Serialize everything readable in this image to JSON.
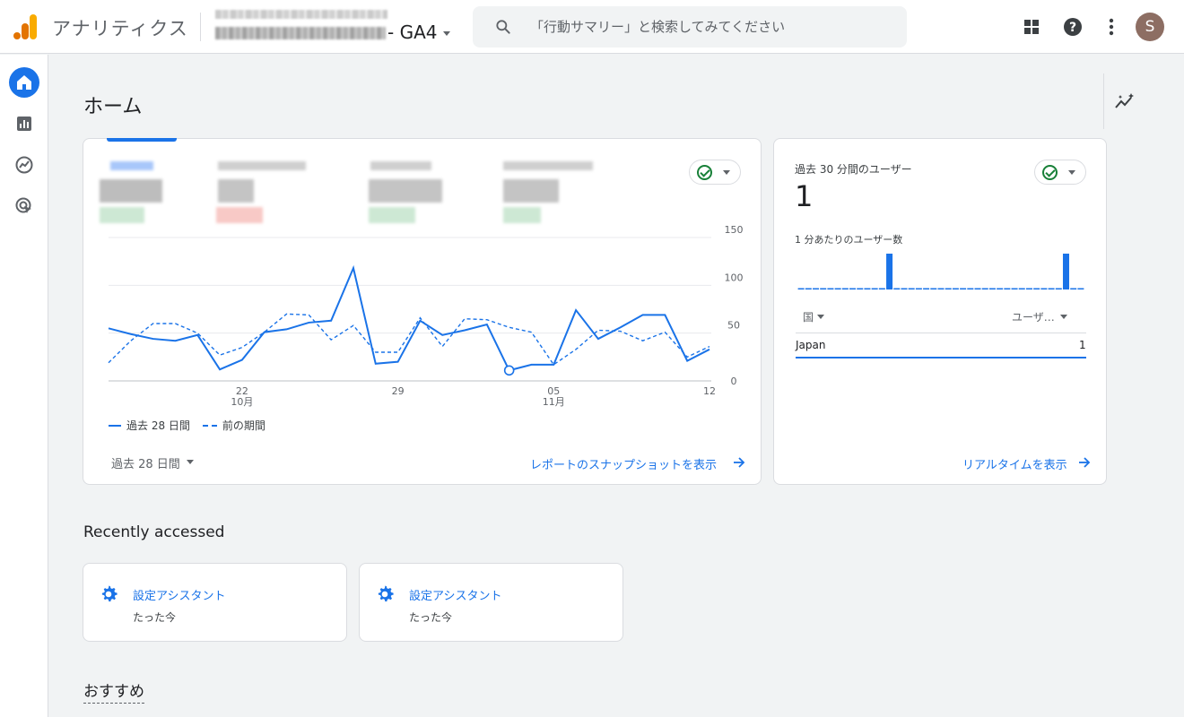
{
  "header": {
    "app_title": "アナリティクス",
    "property_name": "- GA4",
    "search_placeholder": "「行動サマリー」と検索してみてください",
    "avatar_initial": "S"
  },
  "nav": {
    "items": [
      "home-icon",
      "reports-icon",
      "explore-icon",
      "advertising-icon"
    ]
  },
  "page": {
    "title": "ホーム"
  },
  "overview_card": {
    "legend_current": "過去 28 日間",
    "legend_previous": "前の期間",
    "date_range": "過去 28 日間",
    "snapshot_link": "レポートのスナップショットを表示"
  },
  "chart_data": {
    "type": "line",
    "y_ticks": [
      "150",
      "100",
      "50",
      "0"
    ],
    "ylim": [
      0,
      150
    ],
    "x_ticks": [
      {
        "day": "22",
        "month": "10月",
        "index": 6
      },
      {
        "day": "29",
        "month": "",
        "index": 13
      },
      {
        "day": "05",
        "month": "11月",
        "index": 20
      },
      {
        "day": "12",
        "month": "",
        "index": 27
      }
    ],
    "series": [
      {
        "name": "過去 28 日間",
        "values": [
          55,
          49,
          44,
          42,
          48,
          12,
          22,
          51,
          54,
          61,
          63,
          118,
          18,
          20,
          63,
          48,
          53,
          59,
          11,
          17,
          17,
          74,
          44,
          56,
          69,
          69,
          21,
          33
        ]
      },
      {
        "name": "前の期間",
        "values": [
          19,
          42,
          60,
          60,
          50,
          27,
          35,
          51,
          70,
          69,
          43,
          58,
          30,
          30,
          66,
          36,
          65,
          64,
          56,
          51,
          17,
          33,
          53,
          52,
          42,
          51,
          25,
          36
        ]
      }
    ],
    "highlight_index": 18
  },
  "realtime_card": {
    "label": "過去 30 分間のユーザー",
    "value": "1",
    "per_minute_label": "1 分あたりのユーザー数",
    "per_minute_values": [
      0,
      0,
      0,
      0,
      0,
      0,
      0,
      0,
      0,
      0,
      0,
      0,
      1,
      0,
      0,
      0,
      0,
      0,
      0,
      0,
      0,
      0,
      0,
      0,
      0,
      0,
      0,
      0,
      0,
      0,
      0,
      0,
      0,
      0,
      0,
      0,
      1,
      0,
      0
    ],
    "col_country": "国",
    "col_users": "ユーザ…",
    "rows": [
      {
        "country": "Japan",
        "users": "1"
      }
    ],
    "realtime_link": "リアルタイムを表示"
  },
  "recently_accessed": {
    "title": "Recently accessed",
    "items": [
      {
        "title": "設定アシスタント",
        "time": "たった今"
      },
      {
        "title": "設定アシスタント",
        "time": "たった今"
      }
    ]
  },
  "recommended": {
    "title": "おすすめ"
  },
  "colors": {
    "accent": "#1a73e8",
    "status_ok": "#188038"
  }
}
